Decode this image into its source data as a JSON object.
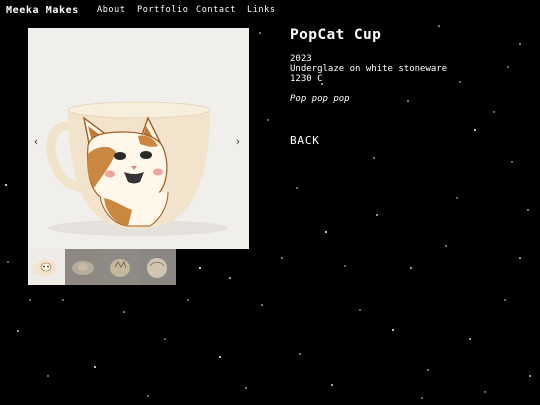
{
  "site": {
    "title": "Meeka Makes"
  },
  "nav": {
    "links": [
      "About",
      "Portfolio",
      "Contact",
      "Links"
    ]
  },
  "gallery": {
    "prev_arrow": "‹",
    "next_arrow": "›",
    "thumbnail_count": 4,
    "active_thumbnail": 1
  },
  "item": {
    "title": "PopCat Cup",
    "year": "2023",
    "material": "Underglaze on white stoneware",
    "firing": "1230 C",
    "description": "Pop pop pop"
  },
  "actions": {
    "back_label": "BACK"
  },
  "colors": {
    "background": "#000000",
    "text": "#ffffff",
    "photo_background": "#f1efeb"
  }
}
